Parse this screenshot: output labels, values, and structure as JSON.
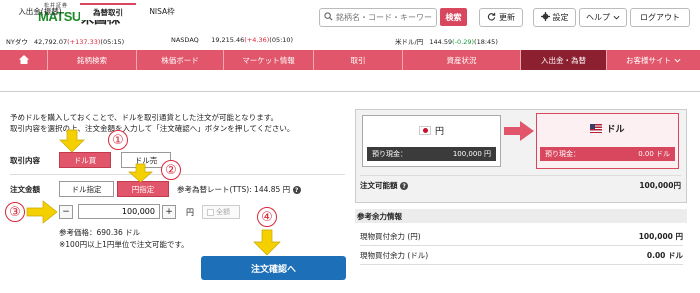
{
  "header": {
    "logo_small": "松井証券",
    "logo_brand": "MATSUI",
    "logo_market": "米国株",
    "search_placeholder": "銘柄名・コード・キーワード",
    "search_button": "検索",
    "refresh": "更新",
    "settings": "設定",
    "help": "ヘルプ",
    "logout": "ログアウト"
  },
  "ticker": {
    "dow_label": "NYダウ",
    "dow_value": "42,792.07",
    "dow_change": "(+137.33)",
    "dow_time": "(05:15)",
    "nasdaq_label": "NASDAQ",
    "nasdaq_value": "19,215.46",
    "nasdaq_change": "(+4.36)",
    "nasdaq_time": "(05:10)",
    "usdjpy_label": "米ドル/円",
    "usdjpy_value": "144.59",
    "usdjpy_change": "(-0.29)",
    "usdjpy_time": "(18:45)"
  },
  "nav": {
    "items": [
      "ホーム",
      "銘柄検索",
      "株価ボード",
      "マーケット情報",
      "取引",
      "資産状況",
      "入出金・為替",
      "お客様サイト"
    ]
  },
  "subtabs": [
    "入出金(振替)",
    "為替取引",
    "NISA枠"
  ],
  "form": {
    "desc_line1": "予めドルを購入しておくことで、ドルを取引通貨とした注文が可能となります。",
    "desc_line2": "取引内容を選択の上、注文金額を入力して「注文確認へ」ボタンを押してください。",
    "trade_label": "取引内容",
    "buy_usd": "ドル買",
    "sell_usd": "ドル売",
    "amount_label": "注文金額",
    "usd_spec": "ドル指定",
    "jpy_spec": "円指定",
    "rate_text": "参考為替レート(TTS): 144.85 円",
    "minus": "−",
    "plus": "+",
    "amount_value": "100,000",
    "amount_unit": "円",
    "all_label": "全額",
    "ref_price": "参考価格：690.36 ドル",
    "note": "※100円以上1円単位で注文可能です。",
    "confirm_button": "注文確認へ"
  },
  "annotations": [
    "①",
    "②",
    "③",
    "④"
  ],
  "right": {
    "jpy_label": "円",
    "usd_label": "ドル",
    "jpy_deposit_label": "預り現金：",
    "jpy_deposit_value": "100,000 円",
    "usd_deposit_label": "預り現金：",
    "usd_deposit_value": "0.00 ドル",
    "orderable_label": "注文可能額",
    "orderable_value": "100,000円",
    "info_title": "参考余力情報",
    "row1_label": "現物買付余力 (円)",
    "row1_value": "100,000 円",
    "row2_label": "現物買付余力 (ドル)",
    "row2_value": "0.00 ドル"
  },
  "colors": {
    "accent": "#e1566a",
    "nav_active": "#8d2030",
    "confirm": "#1d70b8",
    "annotation": "#d8283b",
    "arrow": "#f5d000"
  }
}
